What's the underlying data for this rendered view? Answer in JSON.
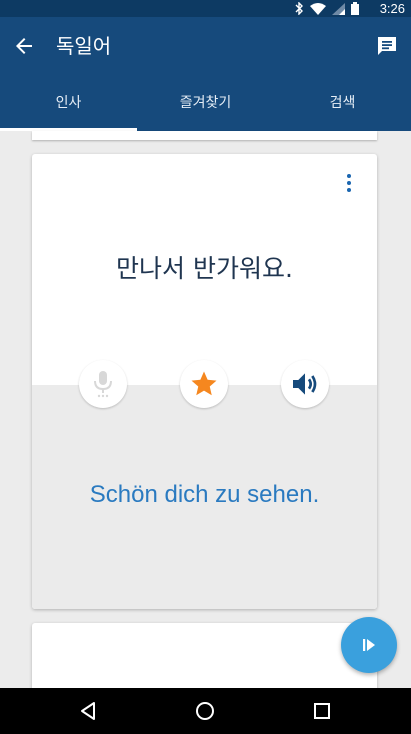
{
  "status_bar": {
    "time": "3:26",
    "icons": [
      "bluetooth-icon",
      "wifi-icon",
      "signal-icon",
      "battery-icon"
    ]
  },
  "app_bar": {
    "title": "독일어",
    "back_icon": "arrow-left-icon",
    "action_icon": "chat-icon"
  },
  "tabs": [
    {
      "label": "인사",
      "selected": true
    },
    {
      "label": "즐겨찾기",
      "selected": false
    },
    {
      "label": "검색",
      "selected": false
    }
  ],
  "card": {
    "source_phrase": "만나서 반가워요.",
    "translation": "Schön dich zu sehen.",
    "favorite": true
  },
  "colors": {
    "primary": "#164a7c",
    "status_bar": "#0d3a63",
    "accent_star": "#f5871f",
    "fab": "#3aa0dd",
    "translation_text": "#2a7ac0"
  }
}
